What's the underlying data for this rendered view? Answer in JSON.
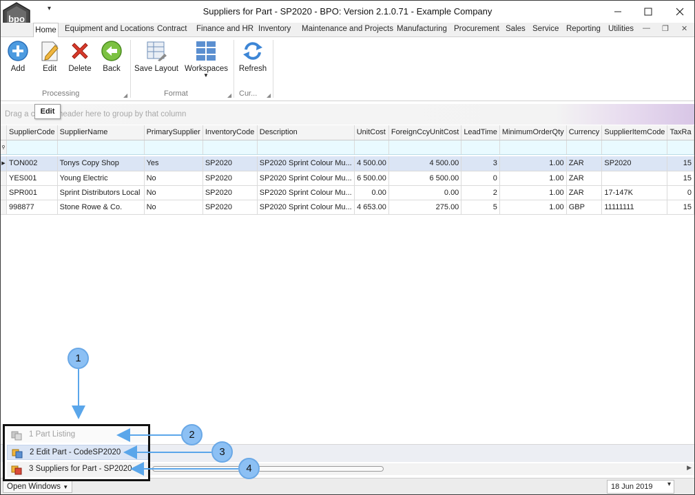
{
  "window": {
    "title": "Suppliers for Part - SP2020 - BPO: Version 2.1.0.71 - Example Company",
    "logo_text": "bpo"
  },
  "menu": {
    "tabs": [
      "Home",
      "Equipment and Locations",
      "Contract",
      "Finance and HR",
      "Inventory",
      "Maintenance and Projects",
      "Manufacturing",
      "Procurement",
      "Sales",
      "Service",
      "Reporting",
      "Utilities"
    ]
  },
  "ribbon": {
    "buttons": {
      "add": "Add",
      "edit": "Edit",
      "delete": "Delete",
      "back": "Back",
      "save_layout": "Save Layout",
      "workspaces": "Workspaces",
      "refresh": "Refresh"
    },
    "groups": {
      "processing": "Processing",
      "format": "Format",
      "currency": "Cur..."
    }
  },
  "tooltip": "Edit",
  "grid": {
    "group_panel_text": "Drag a column header here to group by that column",
    "columns": [
      "SupplierCode",
      "SupplierName",
      "PrimarySupplier",
      "InventoryCode",
      "Description",
      "UnitCost",
      "ForeignCcyUnitCost",
      "LeadTime",
      "MinimumOrderQty",
      "Currency",
      "SupplierItemCode",
      "TaxRa"
    ],
    "rows": [
      [
        "TON002",
        "Tonys Copy Shop",
        "Yes",
        "SP2020",
        "SP2020 Sprint Colour Mu...",
        "4 500.00",
        "4 500.00",
        "3",
        "1.00",
        "ZAR",
        "SP2020",
        "15"
      ],
      [
        "YES001",
        "Young Electric",
        "No",
        "SP2020",
        "SP2020 Sprint Colour Mu...",
        "6 500.00",
        "6 500.00",
        "0",
        "1.00",
        "ZAR",
        "",
        "15"
      ],
      [
        "SPR001",
        "Sprint Distributors Local",
        "No",
        "SP2020",
        "SP2020 Sprint Colour Mu...",
        "0.00",
        "0.00",
        "2",
        "1.00",
        "ZAR",
        "17-147K",
        "0"
      ],
      [
        "998877",
        "Stone Rowe & Co.",
        "No",
        "SP2020",
        "SP2020 Sprint Colour Mu...",
        "4 653.00",
        "275.00",
        "5",
        "1.00",
        "GBP",
        "11111111",
        "15"
      ]
    ]
  },
  "open_windows": {
    "items": [
      "1 Part Listing",
      "2 Edit Part - CodeSP2020",
      "3 Suppliers for Part - SP2020"
    ],
    "button_label": "Open Windows"
  },
  "status": {
    "date": "18 Jun 2019"
  },
  "callouts": [
    "1",
    "2",
    "3",
    "4"
  ],
  "colors": {
    "selected_row": "#dbe5f5",
    "filter_row": "#e9faff",
    "callout_fill": "#8cc0f4",
    "arrow": "#5aa6ea"
  }
}
